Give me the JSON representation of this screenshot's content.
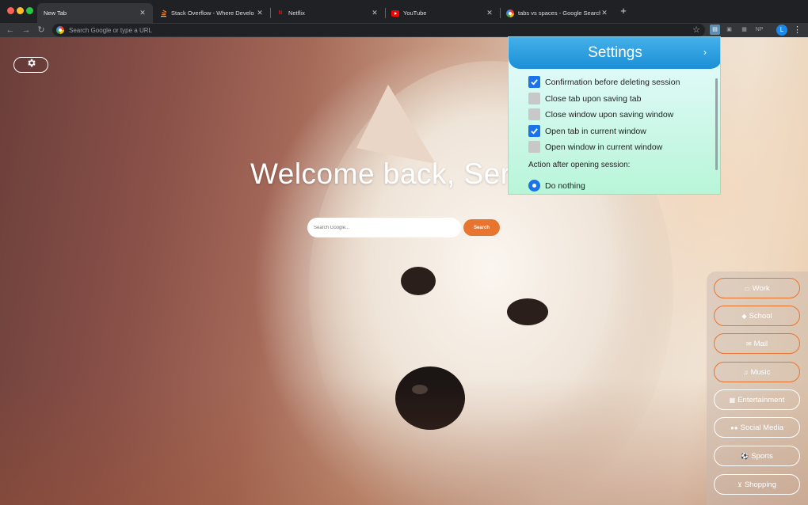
{
  "tabs": [
    {
      "label": "New Tab",
      "favicon": "none",
      "active": true
    },
    {
      "label": "Stack Overflow - Where Develo",
      "favicon": "stackoverflow-icon",
      "active": false
    },
    {
      "label": "Netflix",
      "favicon": "netflix-icon",
      "active": false
    },
    {
      "label": "YouTube",
      "favicon": "youtube-icon",
      "active": false
    },
    {
      "label": "tabs vs spaces - Google Search",
      "favicon": "google-icon",
      "active": false
    }
  ],
  "omnibox": {
    "placeholder": "Search Google or type a URL"
  },
  "profile": {
    "initial": "L"
  },
  "extensions": [
    "NP"
  ],
  "page": {
    "welcome": "Welcome back, Serg",
    "search_placeholder": "Search Google...",
    "search_button": "Search"
  },
  "settings": {
    "title": "Settings",
    "options": [
      {
        "label": "Confirmation before deleting session",
        "checked": true
      },
      {
        "label": "Close tab upon saving tab",
        "checked": false
      },
      {
        "label": "Close window upon saving window",
        "checked": false
      },
      {
        "label": "Open tab in current window",
        "checked": true
      },
      {
        "label": "Open window in current window",
        "checked": false
      }
    ],
    "section": "Action after opening session:",
    "radio_option": "Do nothing"
  },
  "categories": [
    {
      "label": "Work",
      "icon": "briefcase-icon"
    },
    {
      "label": "School",
      "icon": "graduation-cap-icon"
    },
    {
      "label": "Mail",
      "icon": "envelope-icon"
    },
    {
      "label": "Music",
      "icon": "headphones-icon"
    },
    {
      "label": "Entertainment",
      "icon": "film-icon"
    },
    {
      "label": "Social Media",
      "icon": "users-icon"
    },
    {
      "label": "Sports",
      "icon": "soccer-ball-icon"
    },
    {
      "label": "Shopping",
      "icon": "cart-icon"
    }
  ],
  "colors": {
    "accent": "#e8752f",
    "settings_header": "#1a8fd6",
    "checkbox": "#1a73e8"
  }
}
